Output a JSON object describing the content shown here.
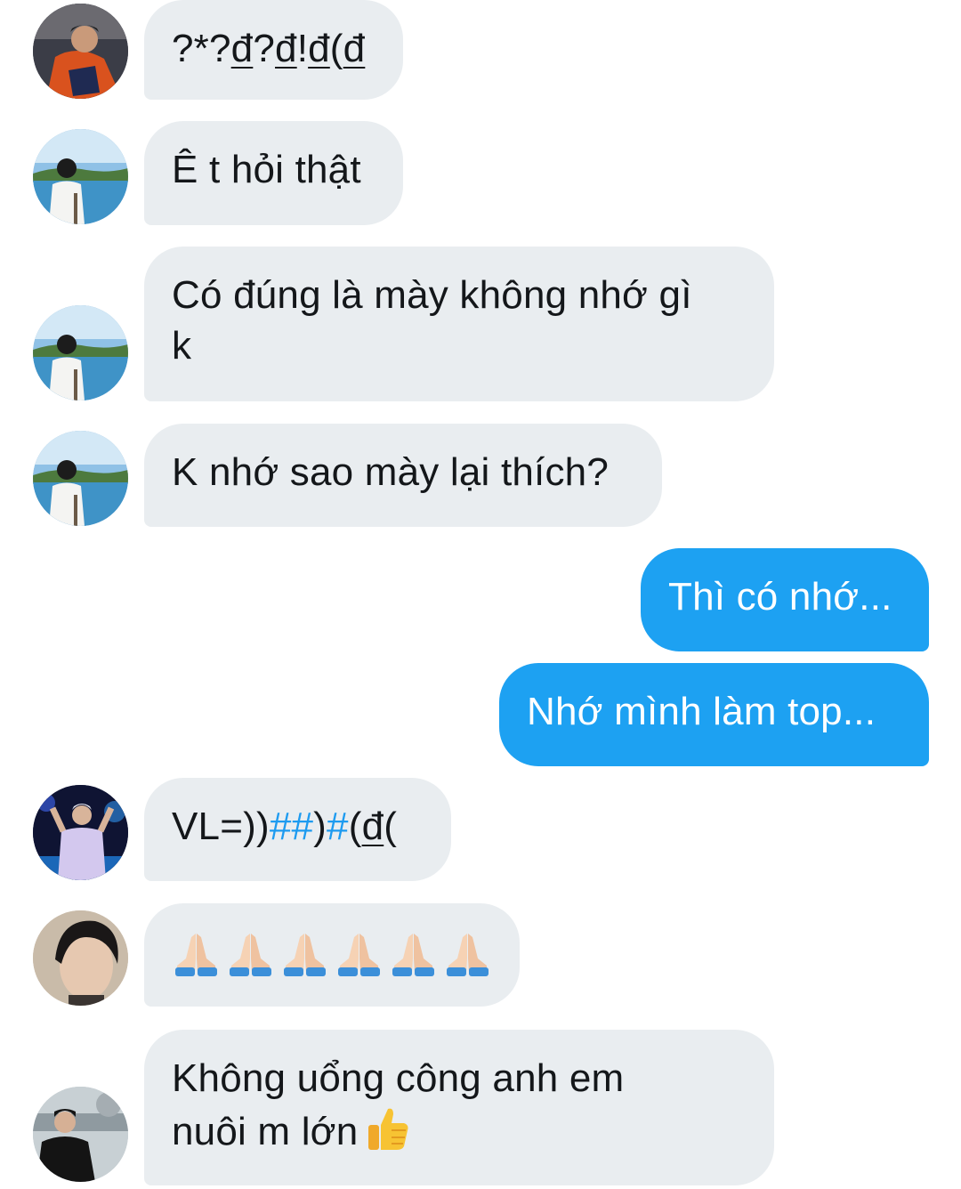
{
  "messages": [
    {
      "id": "m1",
      "direction": "incoming",
      "avatar_icon": "user-avatar-orange-shirt-icon",
      "text": "?*?đ?đ!đ(đ"
    },
    {
      "id": "m2",
      "direction": "incoming",
      "avatar_icon": "user-avatar-seaside-icon",
      "text": "Ê t hỏi thật"
    },
    {
      "id": "m3",
      "direction": "incoming",
      "avatar_icon": "user-avatar-seaside-icon",
      "text_line1": "Có đúng là mày không nhớ gì",
      "text_line2": "k"
    },
    {
      "id": "m4",
      "direction": "incoming",
      "avatar_icon": "user-avatar-seaside-icon",
      "text": "K nhớ sao mày lại thích?"
    },
    {
      "id": "m5",
      "direction": "outgoing",
      "text": "Thì có nhớ..."
    },
    {
      "id": "m6",
      "direction": "outgoing",
      "text": "Nhớ mình làm top..."
    },
    {
      "id": "m7",
      "direction": "incoming",
      "avatar_icon": "user-avatar-concert-icon",
      "text_part1": "VL=))",
      "hashtag1": "##",
      "text_part2": ")",
      "hashtag2": "#",
      "text_part3": "(đ("
    },
    {
      "id": "m8",
      "direction": "incoming",
      "avatar_icon": "user-avatar-portrait-icon",
      "emoji": "folded-hands-icon",
      "emoji_count": 6
    },
    {
      "id": "m9",
      "direction": "incoming",
      "avatar_icon": "user-avatar-dark-jacket-icon",
      "text_line1": "Không uổng công anh em",
      "text_line2": "nuôi m lớn",
      "emoji": "thumbs-up-icon"
    }
  ],
  "colors": {
    "incoming_bubble": "#e9edf0",
    "outgoing_bubble": "#1da1f2",
    "incoming_text": "#14171a",
    "outgoing_text": "#ffffff",
    "hashtag": "#1d9bf0"
  }
}
